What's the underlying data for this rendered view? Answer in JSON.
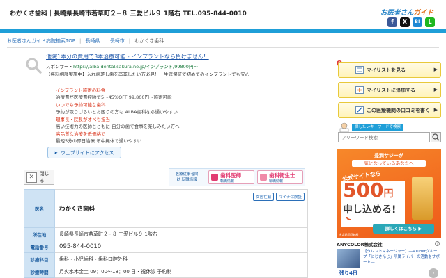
{
  "header": {
    "title": "わかくさ歯科｜長崎県長崎市若草町２−８ 三愛ビル９ 1階右 TEL.095-844-0010",
    "brand_main": "お医者さん",
    "brand_accent": "ガイド",
    "social": {
      "facebook": "f",
      "x": "X",
      "hatena": "B!",
      "line": "L"
    }
  },
  "breadcrumb": {
    "items": [
      "お医者さんガイド病院検索TOP",
      "長崎県",
      "長崎市"
    ],
    "current": "わかくさ歯科",
    "separator": "|"
  },
  "ad": {
    "headline": "他院1本分の費用で3本治療可能 - インプラントなら負けません！",
    "sponsor_label": "スポンサー・",
    "sponsor_url": "https://alba-dental.sakura.ne.jp/インプラント/99800円〜",
    "description": "【無料相談実施中】入れ歯差し歯を卒業したい方必見！一生涯保証で初めてのインプラントでも安心",
    "sublinks": [
      {
        "heading": "インプラント施術の料金",
        "text": "治療費が医療費控除で5〜45%OFF 99,800円〜施術可能"
      },
      {
        "heading": "いつでも予約可能な歯科",
        "text": "予約が取りづらいとお困りの方も ALBA歯科なら通いやすい"
      },
      {
        "heading": "理事長・院長がオペも担当",
        "text": "高い技術力の医師とともに 自分の歯で食事を楽しみたい方へ"
      },
      {
        "heading": "高品質な治療を低価格で",
        "text": "最短5分の即日治療 年中無休で通いやすい"
      }
    ],
    "website_button": "ウェブサイトにアクセス"
  },
  "close_label": "閉じる",
  "recruit": {
    "label": "医療従事者向け 転職情報",
    "cards": [
      {
        "name": "歯科医師",
        "sub": "転職情報"
      },
      {
        "name": "歯科衛生士",
        "sub": "転職情報"
      }
    ]
  },
  "clinic": {
    "labels": {
      "name": "医名",
      "address": "所在地",
      "phone": "電話番号",
      "departments": "診療科目",
      "hours": "診療時間"
    },
    "name": "わかくさ歯科",
    "badges": [
      "女医在勤",
      "マイナ保険証"
    ],
    "address": "長崎県長崎市若草町２−８ 三愛ビル９ 1階右",
    "phone": "095-844-0010",
    "departments": "歯科・小児歯科・歯科口腔外科",
    "hours": "月火水木金土 09：00〜18：00 日・祝休診 予約制"
  },
  "sidebar": {
    "mylist_count": "0",
    "buttons": [
      "マイリストを見る",
      "マイリストに追加する",
      "この医療機関の口コミを書く"
    ],
    "keyword_title": "探したいキーワードで検索",
    "keyword_placeholder": "フリーワード検索"
  },
  "banner": {
    "top": "豊潤サジーが",
    "top2": "気になっているあなたへ",
    "offer": "公式サイトなら",
    "price": "500",
    "yen": "円で",
    "tagline": "申し込める!",
    "cta": "詳しくはこちら ▶",
    "note": "※定期初回価格"
  },
  "company_ad": {
    "name": "ANYCOLOR株式会社",
    "desc": "【タレントマネージャー】―VTuberグループ「にじさんじ」所属ライバーの活動をサポート―",
    "date": "残り4日",
    "info": "i"
  },
  "colors": {
    "accent": "#1f9fd8",
    "link": "#2b6fb8",
    "ad_red": "#d9341b",
    "highlight": "#e8c93a"
  }
}
